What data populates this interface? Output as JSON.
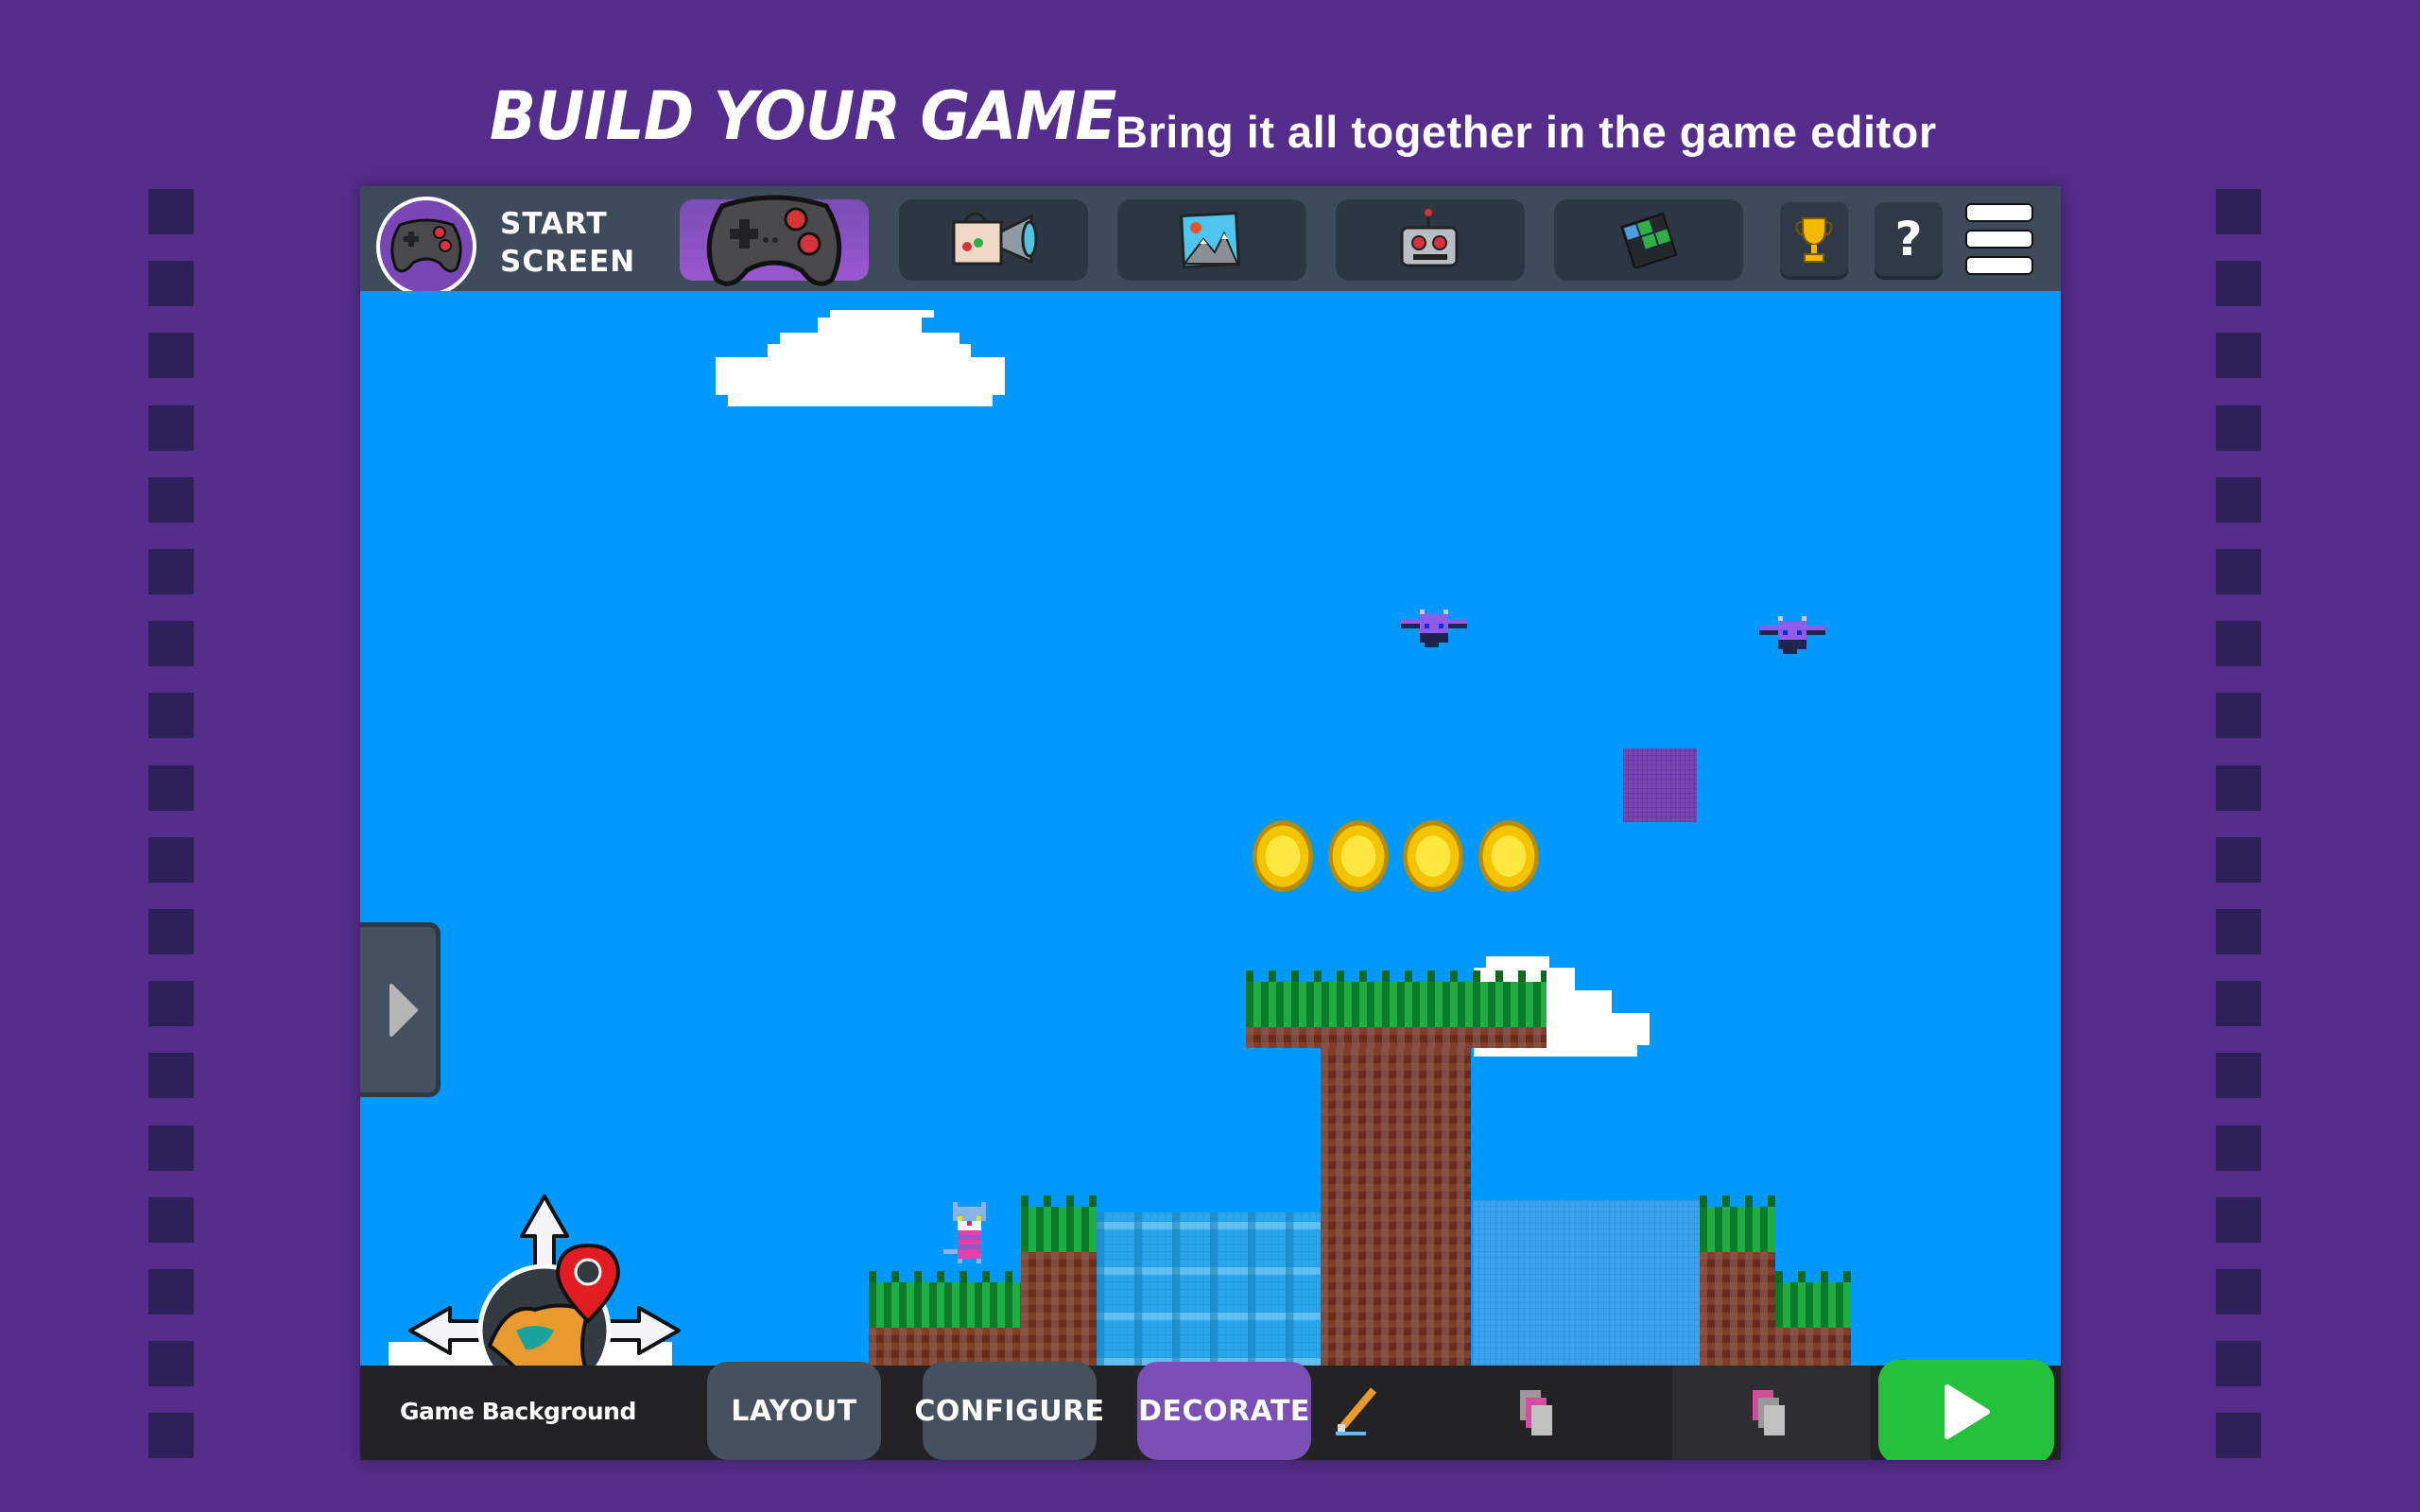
{
  "header": {
    "title": "BUILD YOUR GAME",
    "subtitle": "Bring it all together in the game editor"
  },
  "colors": {
    "page_background": "#552d8c",
    "film_square": "#2d1f58",
    "toolbar": "#3e4b5a",
    "sky": "#0099ff",
    "bottom_bar": "#232224",
    "active_tab": "#7a50b4",
    "play_button": "#26c13c"
  },
  "topbar": {
    "start_screen": {
      "label_line1": "START",
      "label_line2": "SCREEN",
      "icon": "gamepad-icon"
    },
    "tabs": [
      {
        "id": "game",
        "icon": "gamepad-icon",
        "active": true
      },
      {
        "id": "cutscene",
        "icon": "camera-icon",
        "active": false
      },
      {
        "id": "backgrounds",
        "icon": "picture-icon",
        "active": false
      },
      {
        "id": "characters",
        "icon": "robot-icon",
        "active": false
      },
      {
        "id": "tiles",
        "icon": "tile-grid-icon",
        "active": false
      }
    ],
    "buttons": [
      {
        "id": "achievements",
        "icon": "trophy-icon"
      },
      {
        "id": "help",
        "icon": "help-icon",
        "glyph": "?"
      },
      {
        "id": "menu",
        "icon": "hamburger-menu-icon"
      }
    ]
  },
  "canvas": {
    "side_toggle_icon": "chevron-right-icon",
    "navigator_icon": "map-pan-icon",
    "sprites": {
      "coins": 4,
      "enemies": 2,
      "player": 1
    }
  },
  "bottombar": {
    "layer_label": "Game Background",
    "modes": [
      {
        "label": "LAYOUT",
        "active": false
      },
      {
        "label": "CONFIGURE",
        "active": false
      },
      {
        "label": "DECORATE",
        "active": true
      }
    ],
    "tools": [
      {
        "id": "brush",
        "icon": "pencil-icon"
      },
      {
        "id": "layer-back",
        "icon": "layers-back-icon"
      },
      {
        "id": "layer-front",
        "icon": "layers-front-icon"
      }
    ],
    "play_icon": "play-icon"
  }
}
